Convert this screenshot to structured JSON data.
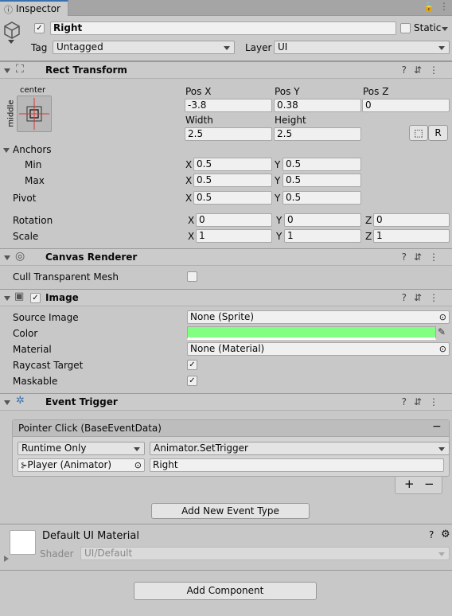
{
  "tab": {
    "label": "Inspector"
  },
  "gameobject": {
    "name": "Right",
    "static_label": "Static",
    "tag_label": "Tag",
    "tag_value": "Untagged",
    "layer_label": "Layer",
    "layer_value": "UI"
  },
  "rect_transform": {
    "title": "Rect Transform",
    "anchor_preset_top": "center",
    "anchor_preset_side": "middle",
    "pos_x_label": "Pos X",
    "pos_y_label": "Pos Y",
    "pos_z_label": "Pos Z",
    "pos_x": "-3.8",
    "pos_y": "0.38",
    "pos_z": "0",
    "width_label": "Width",
    "height_label": "Height",
    "width": "2.5",
    "height": "2.5",
    "raw_button": "R",
    "anchors_label": "Anchors",
    "min_label": "Min",
    "min_x": "0.5",
    "min_y": "0.5",
    "max_label": "Max",
    "max_x": "0.5",
    "max_y": "0.5",
    "pivot_label": "Pivot",
    "pivot_x": "0.5",
    "pivot_y": "0.5",
    "rotation_label": "Rotation",
    "rot_x": "0",
    "rot_y": "0",
    "rot_z": "0",
    "scale_label": "Scale",
    "scale_x": "1",
    "scale_y": "1",
    "scale_z": "1",
    "x": "X",
    "y": "Y",
    "z": "Z"
  },
  "canvas_renderer": {
    "title": "Canvas Renderer",
    "cull_label": "Cull Transparent Mesh"
  },
  "image": {
    "title": "Image",
    "source_label": "Source Image",
    "source_value": "None (Sprite)",
    "color_label": "Color",
    "color_value": "#80ff80",
    "material_label": "Material",
    "material_value": "None (Material)",
    "raycast_label": "Raycast Target",
    "maskable_label": "Maskable"
  },
  "event_trigger": {
    "title": "Event Trigger",
    "event_header": "Pointer Click (BaseEventData)",
    "runtime": "Runtime Only",
    "function": "Animator.SetTrigger",
    "target": "Player (Animator)",
    "argument": "Right",
    "add_event_button": "Add New Event Type"
  },
  "material_section": {
    "title": "Default UI Material",
    "shader_label": "Shader",
    "shader_value": "UI/Default"
  },
  "add_component_button": "Add Component"
}
